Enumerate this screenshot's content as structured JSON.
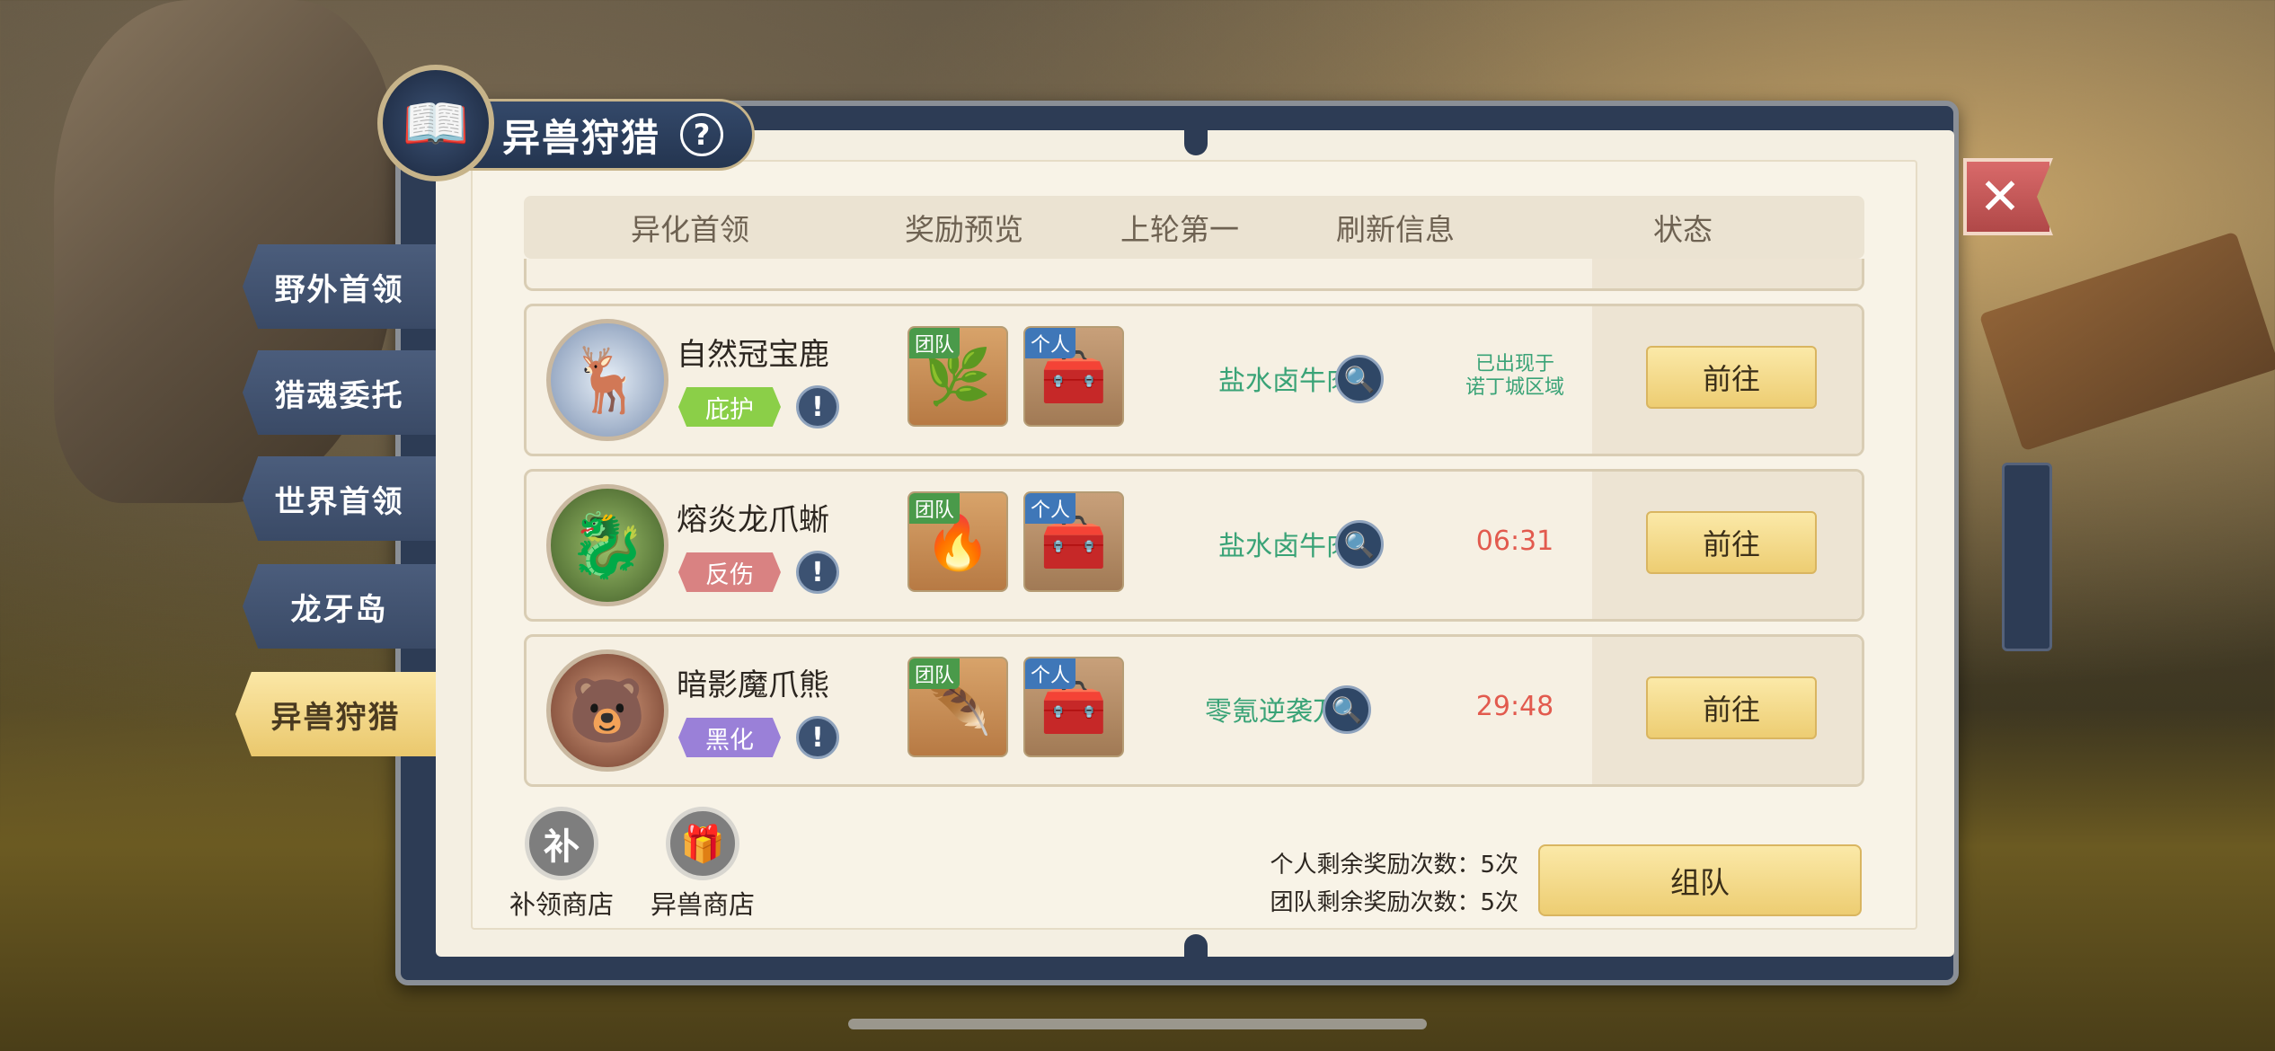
{
  "header": {
    "title": "异兽狩猎",
    "help_symbol": "?"
  },
  "close_symbol": "✕",
  "side_tabs": [
    {
      "label": "野外首领",
      "active": false
    },
    {
      "label": "猎魂委托",
      "active": false
    },
    {
      "label": "世界首领",
      "active": false
    },
    {
      "label": "龙牙岛",
      "active": false
    },
    {
      "label": "异兽狩猎",
      "active": true
    }
  ],
  "table": {
    "columns": [
      "异化首领",
      "奖励预览",
      "上轮第一",
      "刷新信息",
      "状态"
    ]
  },
  "rows": [
    {
      "boss_name": "自然冠宝鹿",
      "avatar_icon": "deer-icon",
      "trait": "庇护",
      "trait_color": "#8bcf48",
      "team_tag": "团队",
      "personal_tag": "个人",
      "team_reward_icon": "green-leaf-icon",
      "personal_reward_icon": "treasure-chest-icon",
      "top_player": "盐水卤牛肉",
      "refresh_line1": "已出现于",
      "refresh_line2": "诺丁城区域",
      "refresh_timer": "",
      "action": "前往"
    },
    {
      "boss_name": "熔炎龙爪蜥",
      "avatar_icon": "dragon-icon",
      "trait": "反伤",
      "trait_color": "#d98282",
      "team_tag": "团队",
      "personal_tag": "个人",
      "team_reward_icon": "fire-feather-icon",
      "personal_reward_icon": "treasure-chest-icon",
      "top_player": "盐水卤牛肉",
      "refresh_line1": "",
      "refresh_line2": "",
      "refresh_timer": "06:31",
      "action": "前往"
    },
    {
      "boss_name": "暗影魔爪熊",
      "avatar_icon": "bear-icon",
      "trait": "黑化",
      "trait_color": "#9a80d8",
      "team_tag": "团队",
      "personal_tag": "个人",
      "team_reward_icon": "purple-feather-icon",
      "personal_reward_icon": "treasure-chest-icon",
      "top_player": "零氪逆袭万氪",
      "refresh_line1": "",
      "refresh_line2": "",
      "refresh_timer": "29:48",
      "action": "前往"
    }
  ],
  "shops": [
    {
      "icon_char": "补",
      "label": "补领商店"
    },
    {
      "icon_char": "🎁",
      "label": "异兽商店"
    }
  ],
  "reward_counts": {
    "personal": "个人剩余奖励次数：5次",
    "team": "团队剩余奖励次数：5次"
  },
  "team_button": "组队"
}
